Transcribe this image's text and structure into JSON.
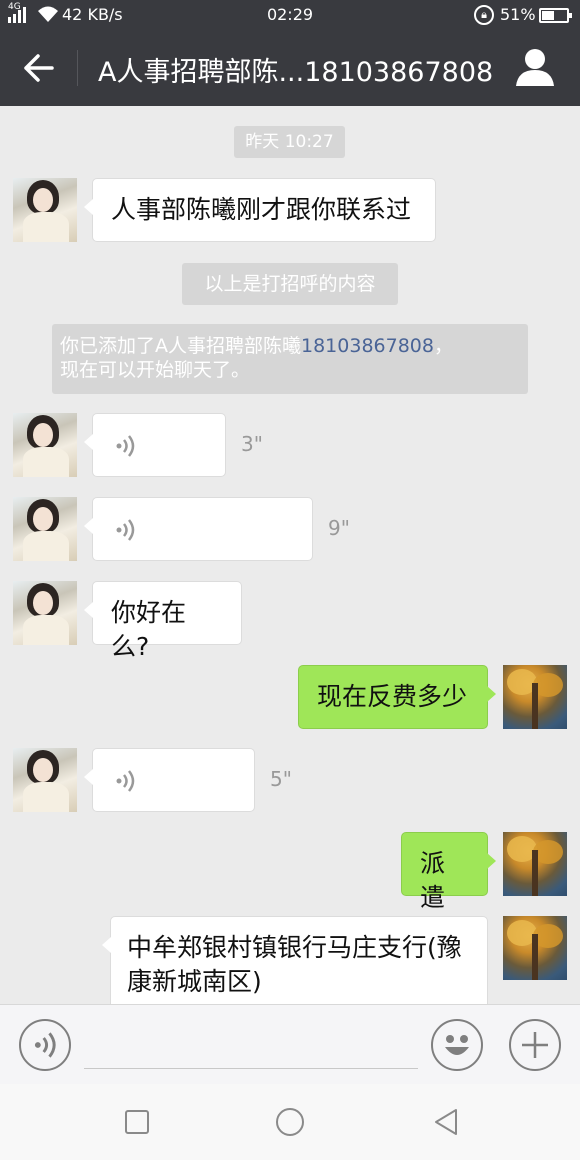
{
  "status_bar": {
    "network": "4G",
    "speed": "42 KB/s",
    "time": "02:29",
    "battery": "51%",
    "battery_level": 0.51
  },
  "header": {
    "title": "A人事招聘部陈...18103867808",
    "back_icon": "back-arrow-icon",
    "profile_icon": "person-icon"
  },
  "chat": {
    "timestamp": "昨天 10:27",
    "system": {
      "greeting_note": "以上是打招呼的内容",
      "added_prefix": "你已添加了A人事招聘部陈曦",
      "added_phone": "18103867808",
      "added_suffix": "，",
      "added_line2": "现在可以开始聊天了。"
    },
    "messages": [
      {
        "from": "contact",
        "type": "text",
        "text": "人事部陈曦刚才跟你联系过"
      },
      {
        "from": "contact",
        "type": "voice",
        "duration": "3\""
      },
      {
        "from": "contact",
        "type": "voice",
        "duration": "9\""
      },
      {
        "from": "contact",
        "type": "text",
        "text": "你好在么?"
      },
      {
        "from": "me",
        "type": "text",
        "text": "现在反费多少"
      },
      {
        "from": "contact",
        "type": "voice",
        "duration": "5\""
      },
      {
        "from": "me",
        "type": "text",
        "text": "派遣"
      },
      {
        "from": "me",
        "type": "text",
        "text": "中牟郑银村镇银行马庄支行(豫康新城南区)"
      }
    ],
    "last_message_line1": "中牟郑银村镇银行马庄支行(豫",
    "last_message_line2": "康新城南区)"
  },
  "input_bar": {
    "voice_icon": "voice-mode-icon",
    "emoji_icon": "emoji-icon",
    "more_icon": "plus-icon",
    "input_value": ""
  },
  "nav_bar": {
    "icons": [
      "recent-apps-icon",
      "home-icon",
      "back-triangle-icon"
    ]
  },
  "colors": {
    "header_bg": "#393a3f",
    "chat_bg": "#ebebeb",
    "outgoing_bubble": "#9fe658",
    "incoming_bubble": "#ffffff",
    "phone_link": "#4a6496"
  }
}
